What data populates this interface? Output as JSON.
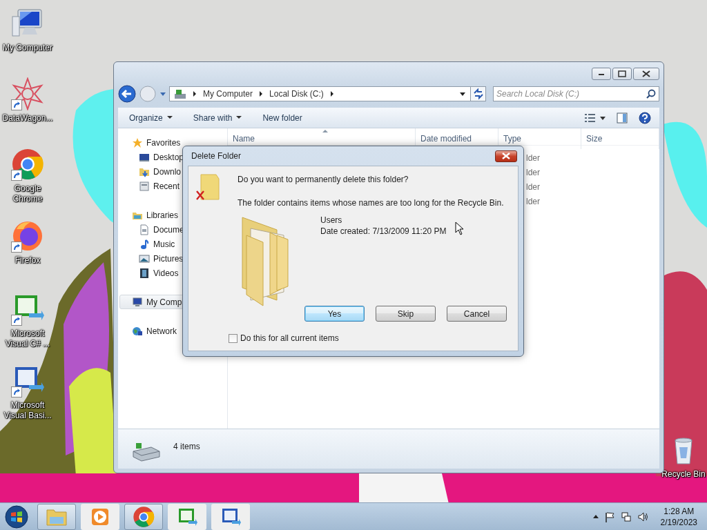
{
  "desktop": {
    "icons": [
      {
        "label": "My Computer",
        "kind": "computer",
        "shortcut": false
      },
      {
        "label": "DataWagon...",
        "kind": "datawagon",
        "shortcut": true
      },
      {
        "label": "Google Chrome",
        "kind": "chrome",
        "shortcut": true
      },
      {
        "label": "Firefox",
        "kind": "firefox",
        "shortcut": true
      },
      {
        "label": "Microsoft Visual C# ...",
        "kind": "csharp",
        "shortcut": true
      },
      {
        "label": "Microsoft Visual Basi...",
        "kind": "vb",
        "shortcut": true
      },
      {
        "label": "Recycle Bin",
        "kind": "recycle",
        "shortcut": false
      }
    ]
  },
  "explorer": {
    "address": [
      "My Computer",
      "Local Disk (C:)"
    ],
    "search": {
      "placeholder": "Search Local Disk (C:)"
    },
    "toolbar": [
      {
        "label": "Organize",
        "dropdown": true
      },
      {
        "label": "Share with",
        "dropdown": true
      },
      {
        "label": "New folder",
        "dropdown": false
      }
    ],
    "nav": [
      {
        "label": "Favorites",
        "kind": "favorites",
        "selected": false,
        "children": [
          {
            "label": "Desktop",
            "kind": "desktop",
            "selected": false
          },
          {
            "label": "Downlo",
            "kind": "downloads",
            "selected": false
          },
          {
            "label": "Recent",
            "kind": "recent",
            "selected": false
          }
        ]
      },
      {
        "label": "Libraries",
        "kind": "libraries",
        "selected": false,
        "children": [
          {
            "label": "Docume",
            "kind": "documents",
            "selected": false
          },
          {
            "label": "Music",
            "kind": "music",
            "selected": false
          },
          {
            "label": "Pictures",
            "kind": "pictures",
            "selected": false
          },
          {
            "label": "Videos",
            "kind": "videos",
            "selected": false
          }
        ]
      },
      {
        "label": "My Comp",
        "kind": "computer",
        "selected": true
      },
      {
        "label": "Network",
        "kind": "network",
        "selected": false
      }
    ],
    "columns": [
      "Name",
      "Date modified",
      "Type",
      "Size"
    ],
    "rows": [
      {
        "type": "lder"
      },
      {
        "type": "lder"
      },
      {
        "type": "lder"
      },
      {
        "type": "lder"
      }
    ],
    "status": "4 items"
  },
  "dialog": {
    "title": "Delete Folder",
    "question": "Do you want to permanently delete this folder?",
    "message": "The folder contains items whose names are too long for the Recycle Bin.",
    "item_name": "Users",
    "item_date": "Date created: 7/13/2009 11:20 PM",
    "buttons": [
      {
        "label": "Yes",
        "default": true
      },
      {
        "label": "Skip",
        "default": false
      },
      {
        "label": "Cancel",
        "default": false
      }
    ],
    "checkbox": {
      "label": "Do this for all current items",
      "checked": false
    }
  },
  "taskbar": {
    "items": [
      {
        "kind": "explorer",
        "open": true
      },
      {
        "kind": "media",
        "open": false
      },
      {
        "kind": "chrome",
        "open": true
      },
      {
        "kind": "csharp",
        "open": false
      },
      {
        "kind": "vb",
        "open": false
      }
    ],
    "time": "1:28 AM",
    "date": "2/19/2023"
  }
}
